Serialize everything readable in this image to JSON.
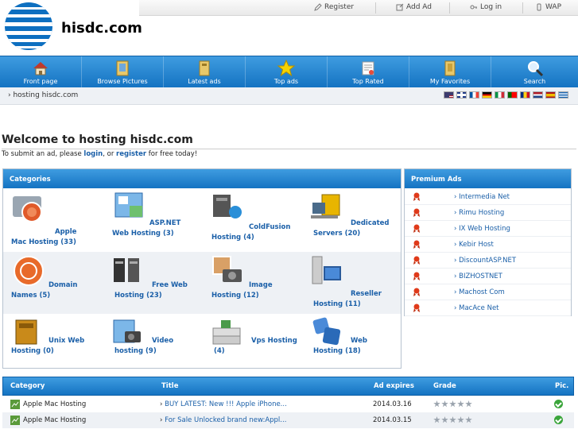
{
  "header": {
    "site_title": "hisdc.com",
    "toplinks": [
      {
        "label": "Register",
        "icon": "pencil-icon"
      },
      {
        "label": "Add Ad",
        "icon": "edit-icon"
      },
      {
        "label": "Log in",
        "icon": "key-icon"
      },
      {
        "label": "WAP",
        "icon": "phone-icon"
      }
    ]
  },
  "nav": {
    "items": [
      {
        "label": "Front page",
        "icon": "house-icon"
      },
      {
        "label": "Browse Pictures",
        "icon": "pictures-icon"
      },
      {
        "label": "Latest ads",
        "icon": "folder-icon"
      },
      {
        "label": "Top ads",
        "icon": "star-icon"
      },
      {
        "label": "Top Rated",
        "icon": "rating-icon"
      },
      {
        "label": "My Favorites",
        "icon": "favorites-icon"
      },
      {
        "label": "Search",
        "icon": "magnifier-icon"
      }
    ]
  },
  "breadcrumb": {
    "text": "hosting hisdc.com"
  },
  "flags": [
    "us",
    "uk",
    "fr",
    "de",
    "it",
    "pt",
    "ro",
    "nl",
    "es",
    "gr"
  ],
  "welcome": {
    "title": "Welcome to hosting hisdc.com",
    "text_before": "To submit an ad, please ",
    "login_link": "login",
    "text_middle": ", or ",
    "register_link": "register",
    "text_after": " for free today!"
  },
  "categories": {
    "heading": "Categories",
    "items": [
      {
        "label": "Apple Mac Hosting (33)",
        "icon": "apple-mac-icon"
      },
      {
        "label": "ASP.NET Web Hosting (3)",
        "icon": "aspnet-icon"
      },
      {
        "label": "ColdFusion Hosting (4)",
        "icon": "coldfusion-icon"
      },
      {
        "label": "Dedicated Servers (20)",
        "icon": "dedicated-server-icon"
      },
      {
        "label": "Domain Names (5)",
        "icon": "domain-icon"
      },
      {
        "label": "Free Web Hosting (23)",
        "icon": "free-web-icon"
      },
      {
        "label": "Image Hosting (12)",
        "icon": "image-hosting-icon"
      },
      {
        "label": "Reseller Hosting (11)",
        "icon": "reseller-icon"
      },
      {
        "label": "Unix Web Hosting (0)",
        "icon": "unix-icon"
      },
      {
        "label": "Video hosting (9)",
        "icon": "video-icon"
      },
      {
        "label": "Vps Hosting (4)",
        "icon": "vps-icon"
      },
      {
        "label": "Web Hosting (18)",
        "icon": "web-hosting-icon"
      }
    ]
  },
  "premium": {
    "heading": "Premium Ads",
    "items": [
      "Intermedia Net",
      "Rimu Hosting",
      "IX Web Hosting",
      "Kebir Host",
      "DiscountASP.NET",
      "BIZHOSTNET",
      "Machost Com",
      "MacAce Net"
    ]
  },
  "ads_table": {
    "columns": [
      "Category",
      "Title",
      "Ad expires",
      "Grade",
      "Pic."
    ],
    "rows": [
      {
        "category": "Apple Mac Hosting",
        "title": "BUY LATEST: New !!! Apple iPhone...",
        "expires": "2014.03.16"
      },
      {
        "category": "Apple Mac Hosting",
        "title": "For Sale Unlocked brand new:Appl...",
        "expires": "2014.03.15"
      }
    ]
  },
  "colors": {
    "nav_blue": "#1473c2",
    "link_blue": "#1a5fa8"
  }
}
